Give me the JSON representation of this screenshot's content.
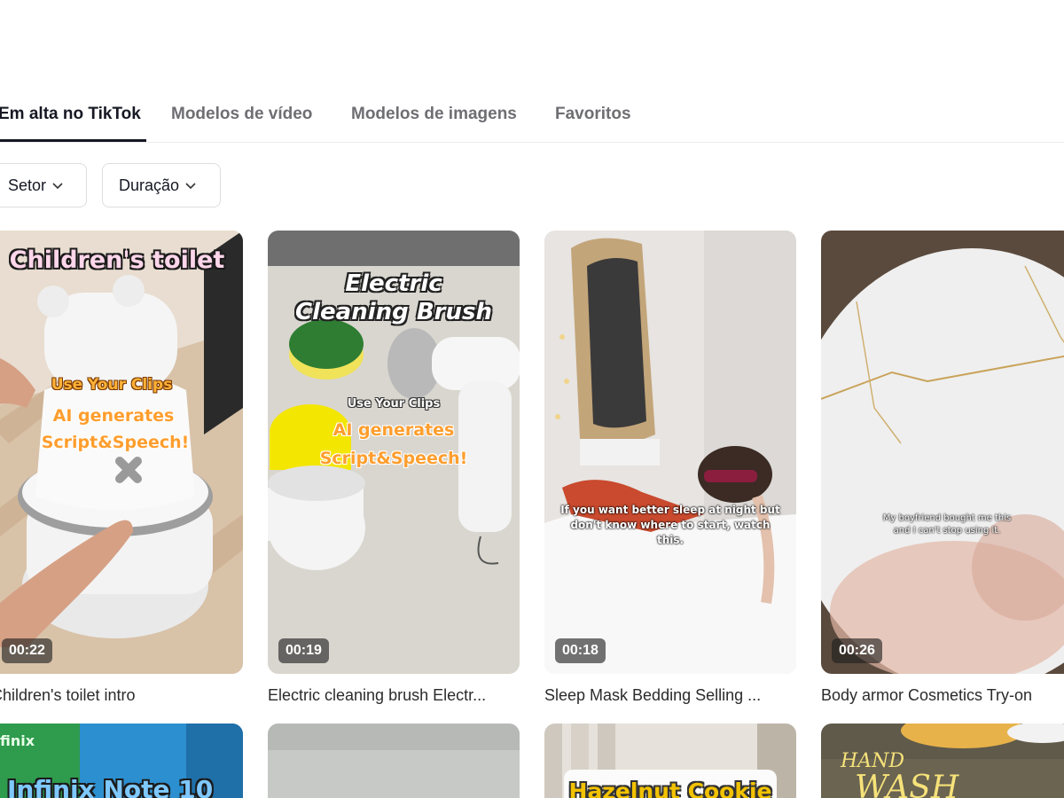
{
  "tabs": [
    {
      "label": "Em alta no TikTok",
      "active": true
    },
    {
      "label": "Modelos de vídeo",
      "active": false
    },
    {
      "label": "Modelos de imagens",
      "active": false
    },
    {
      "label": "Favoritos",
      "active": false
    }
  ],
  "filters": [
    {
      "label": "Setor",
      "icon": "chevron-down-icon"
    },
    {
      "label": "Duração",
      "icon": "chevron-down-icon"
    }
  ],
  "cards": [
    {
      "title": "Children's toilet intro",
      "duration": "00:22",
      "overlay": {
        "headline": "Children's toilet",
        "line1": "Use Your Clips",
        "line2": "AI generates",
        "line3": "Script&Speech!"
      }
    },
    {
      "title": "Electric cleaning brush Electr...",
      "duration": "00:19",
      "overlay": {
        "headline1": "Electric",
        "headline2": "Cleaning Brush",
        "line1": "Use Your Clips",
        "line2": "AI generates",
        "line3": "Script&Speech!"
      }
    },
    {
      "title": "Sleep Mask Bedding Selling ...",
      "duration": "00:18",
      "overlay": {
        "caption": "If you want better sleep at night but don't know where to start, watch this."
      }
    },
    {
      "title": "Body armor Cosmetics Try-on",
      "duration": "00:26",
      "overlay": {
        "caption": "My boyfriend bought me this and I can't stop using it."
      }
    }
  ],
  "row2": [
    {
      "overlay_text": "finix",
      "headline": "Infinix Note 10"
    },
    {
      "overlay_text": ""
    },
    {
      "headline": "Hazelnut Cookie"
    },
    {
      "line1": "HAND",
      "line2": "WASH"
    }
  ],
  "colors": {
    "text_primary": "#161823",
    "text_secondary": "#6e6e73",
    "border": "#dedede",
    "duration_badge": "rgba(30,30,30,0.62)"
  }
}
